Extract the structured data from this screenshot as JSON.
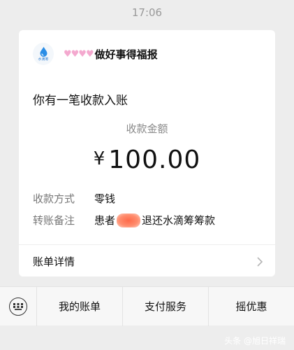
{
  "status_bar": {
    "time": "17:06"
  },
  "notification": {
    "app_logo_text": "水滴筹",
    "sender_name": "做好事得福报",
    "title": "你有一笔收款入账",
    "amount_label": "收款金额",
    "currency_symbol": "¥",
    "amount": "100.00",
    "details": [
      {
        "key": "收款方式",
        "value": "零钱"
      },
      {
        "key": "转账备注",
        "value_prefix": "患者",
        "value_suffix": "退还水滴筹筹款"
      }
    ],
    "detail_link": "账单详情"
  },
  "bottom_menu": {
    "items": [
      "我的账单",
      "支付服务",
      "摇优惠"
    ]
  },
  "watermark": "头条 @旭日祥瑞",
  "colors": {
    "background": "#ededed",
    "redaction": "#ff6a4a",
    "hearts": "#f4a9cf"
  }
}
